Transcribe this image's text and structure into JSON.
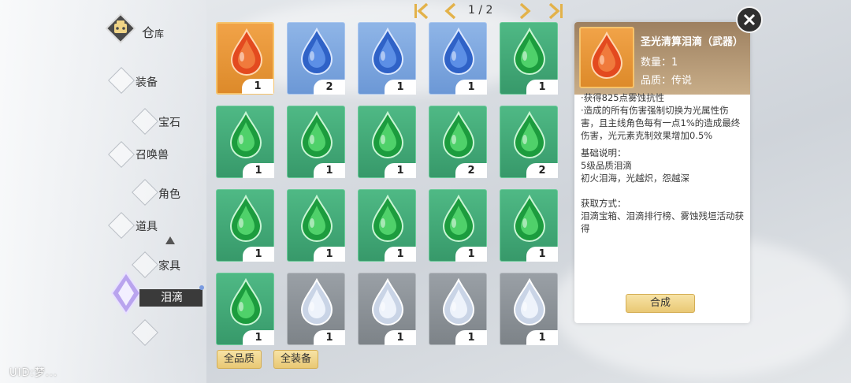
{
  "user": {
    "uid": "UID:梦..."
  },
  "warehouse": {
    "title_main": "仓",
    "title_sub": "库"
  },
  "categories": [
    "装备",
    "宝石",
    "召唤兽",
    "角色",
    "道具",
    "家具"
  ],
  "active_category": "泪滴",
  "pagination": {
    "text": "1 / 2"
  },
  "grid": [
    {
      "color": "orange",
      "count": "1"
    },
    {
      "color": "blue",
      "count": "2"
    },
    {
      "color": "blue",
      "count": "1"
    },
    {
      "color": "blue",
      "count": "1"
    },
    {
      "color": "green",
      "count": "1"
    },
    {
      "color": "green",
      "count": "1"
    },
    {
      "color": "green",
      "count": "1"
    },
    {
      "color": "green",
      "count": "1"
    },
    {
      "color": "green",
      "count": "2"
    },
    {
      "color": "green",
      "count": "2"
    },
    {
      "color": "green",
      "count": "1"
    },
    {
      "color": "green",
      "count": "1"
    },
    {
      "color": "green",
      "count": "1"
    },
    {
      "color": "green",
      "count": "1"
    },
    {
      "color": "green",
      "count": "1"
    },
    {
      "color": "green",
      "count": "1"
    },
    {
      "color": "gray",
      "count": "1"
    },
    {
      "color": "gray",
      "count": "1"
    },
    {
      "color": "gray",
      "count": "1"
    },
    {
      "color": "gray",
      "count": "1"
    }
  ],
  "filters": {
    "quality": "全品质",
    "equipment": "全装备"
  },
  "detail": {
    "name": "圣光清算泪滴（武器）",
    "quantity": "数量：1",
    "quality": "品质：传说",
    "effect_lines": [
      "·获得825点雾蚀抗性",
      "·造成的所有伤害强制切换为光属性伤害，且主线角色每有一点1%的造成最终伤害，光元素克制效果增加0.5%"
    ],
    "basic_title": "基础说明：",
    "basic_lines": [
      "5级品质泪滴",
      "初火泪海，光越炽，怨越深"
    ],
    "source_title": "获取方式：",
    "source_lines": [
      "泪滴宝箱、泪滴排行榜、雾蚀残垣活动获得"
    ],
    "synth_label": "合成"
  },
  "colors": {
    "orange": "#e8952f",
    "blue": "#7ea8e0",
    "green": "#40a874",
    "gray": "#8c9298",
    "gold": "#e9c874"
  },
  "icons": [
    "warehouse-icon",
    "first-page-icon",
    "prev-page-icon",
    "next-page-icon",
    "last-page-icon",
    "close-icon",
    "teardrop-gem-icon"
  ]
}
